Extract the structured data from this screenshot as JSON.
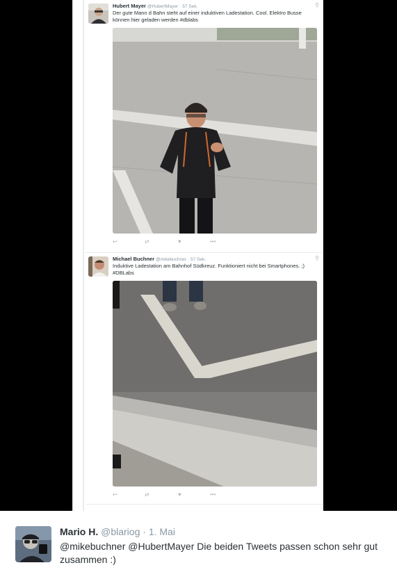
{
  "tweets": [
    {
      "name": "Hubert Mayer",
      "handle": "@HubertMayer",
      "time": "· 57 Sek.",
      "text": "Der gute Mann d Bahn steht auf einer induktiven Ladestation. Cool. Elektro Busse können hier geladen werden #dblabs"
    },
    {
      "name": "Michael Buchner",
      "handle": "@mikebuchner",
      "time": "· 57 Sek.",
      "text": "Induktive Ladestation am Bahnhof Südkreuz. Funktioniert nicht bei Smartphones. ;) #DBLabs"
    }
  ],
  "icons": {
    "reply": "reply-icon",
    "retweet": "retweet-icon",
    "like": "heart-icon",
    "more": "more-icon",
    "location": "location-pin-icon"
  },
  "reply": {
    "name": "Mario H.",
    "handle": "@blariog",
    "date": "· 1. Mai",
    "text": "@mikebuchner @HubertMayer Die beiden Tweets passen schon sehr gut zusammen :)"
  },
  "colors": {
    "text": "#292f33",
    "muted": "#8899a6",
    "border": "#e6ecf0",
    "background": "#000000"
  }
}
